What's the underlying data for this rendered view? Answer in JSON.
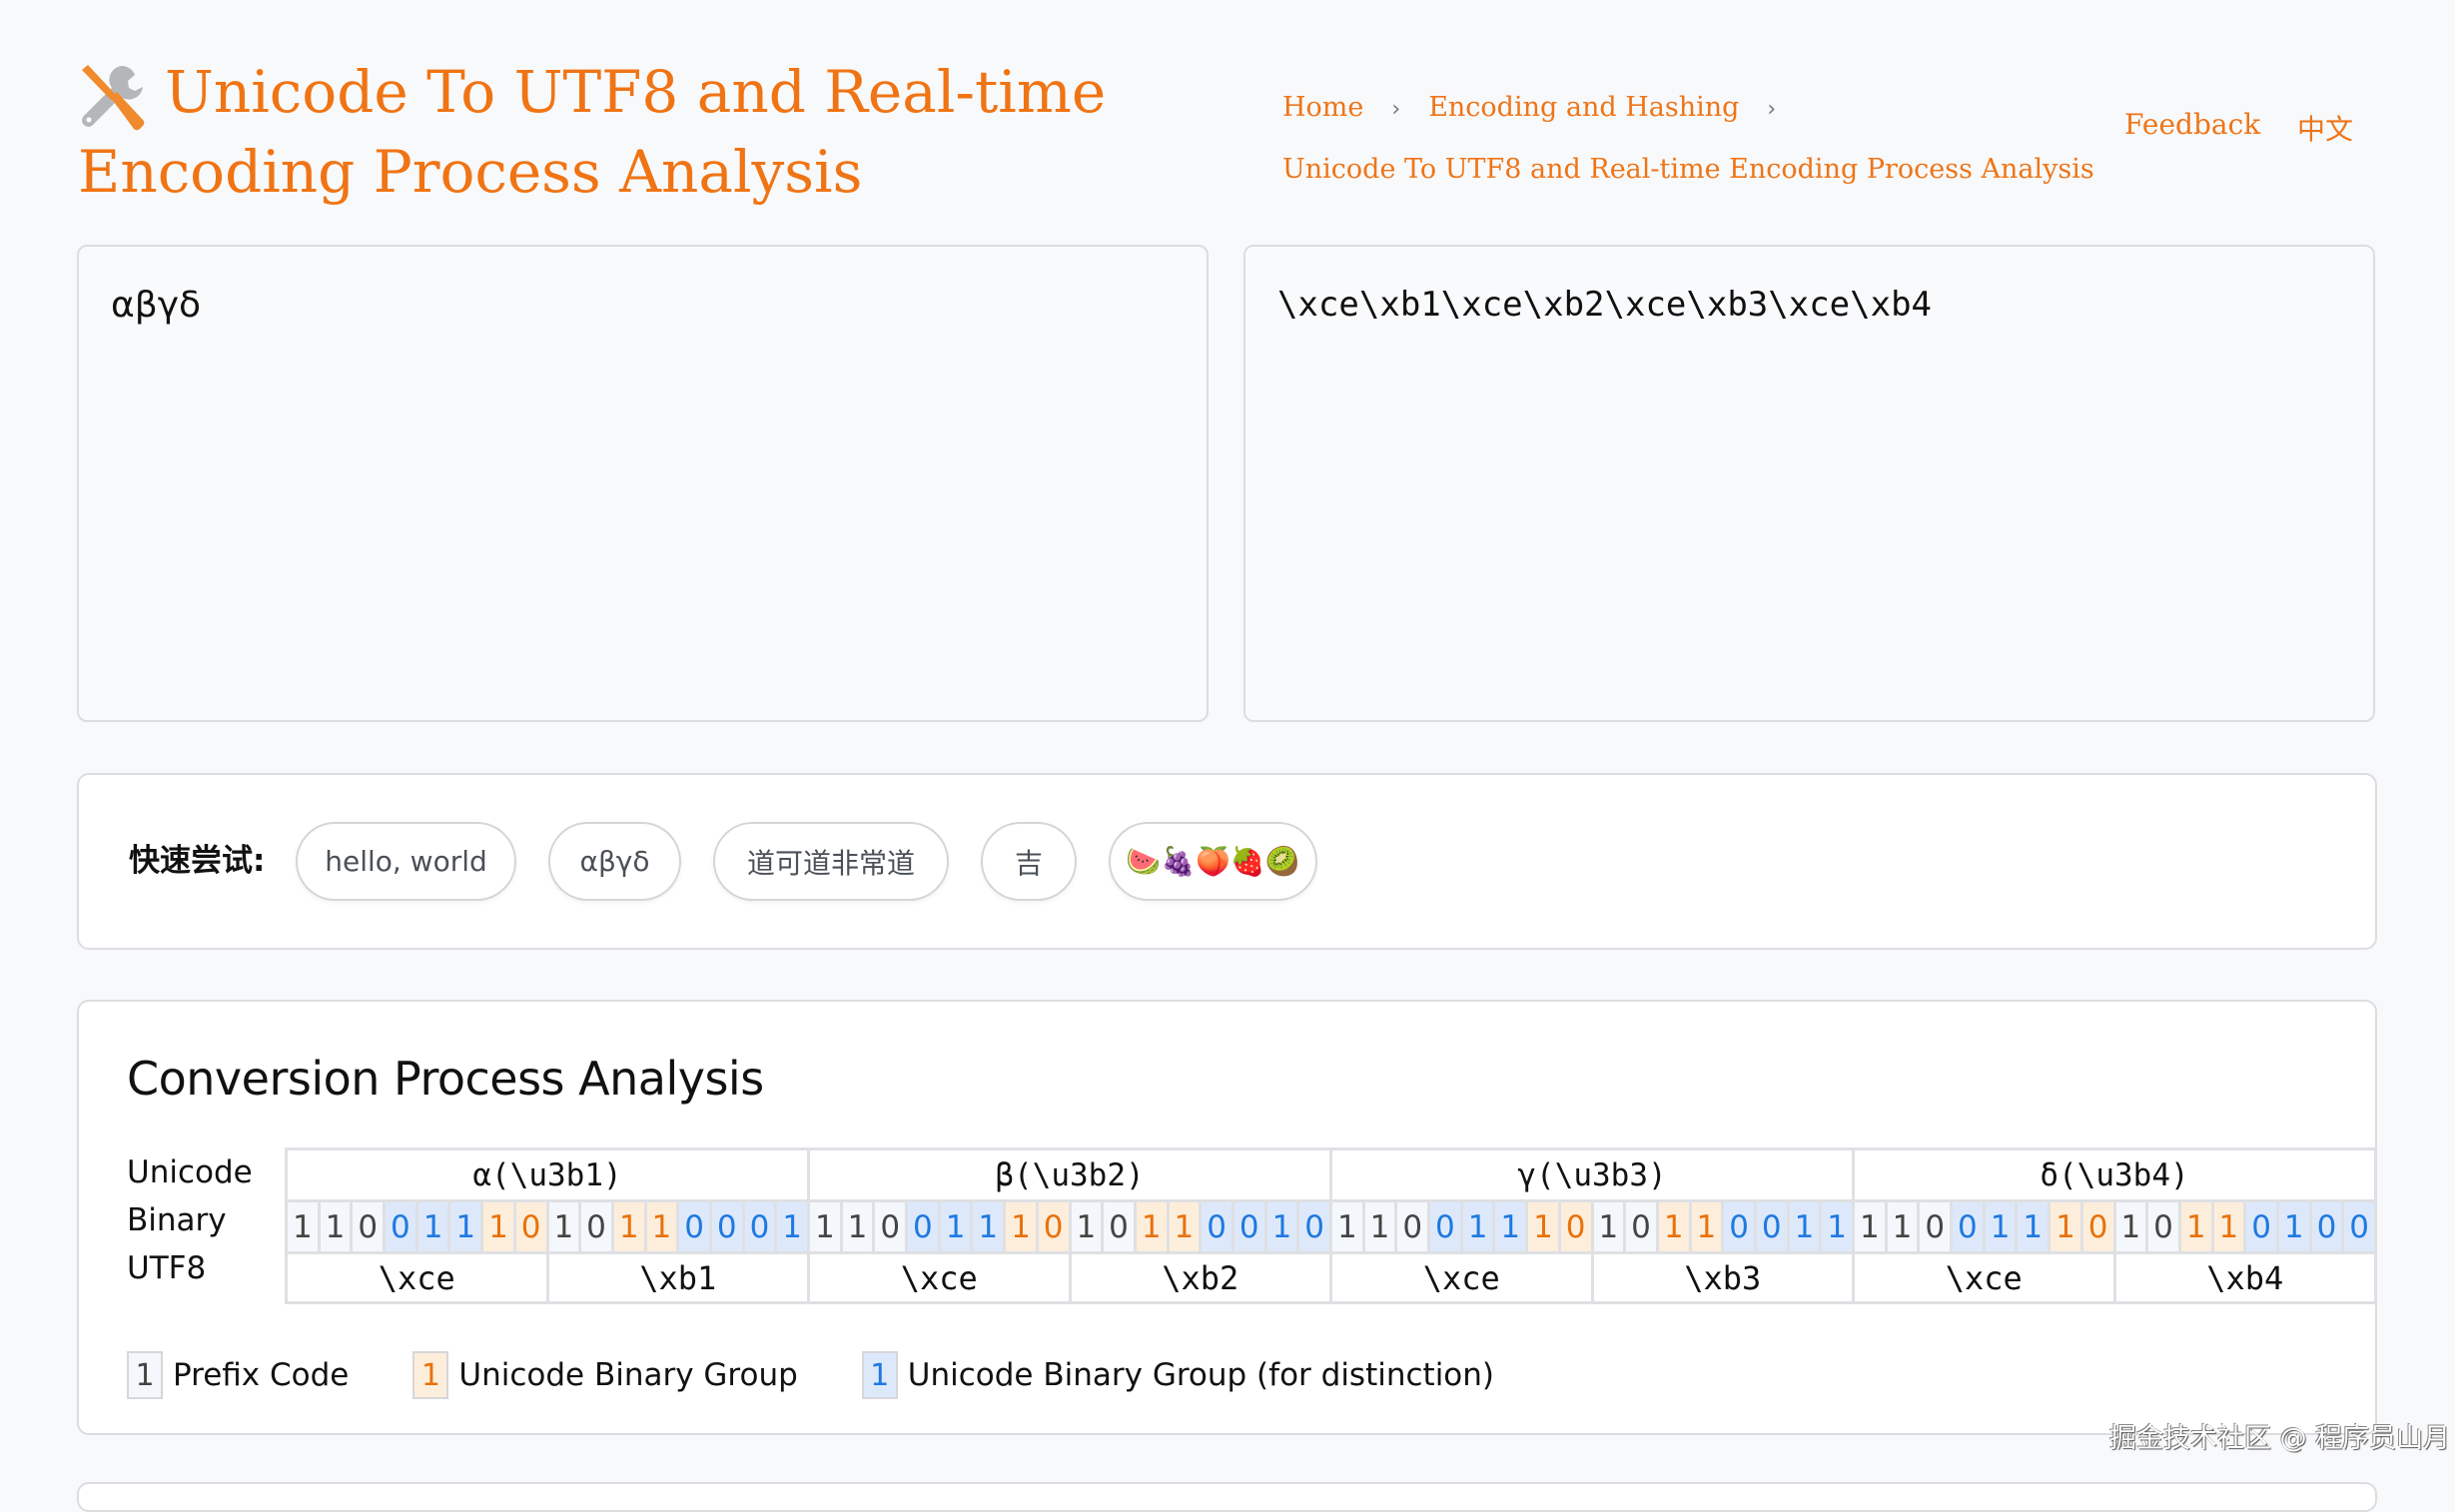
{
  "header": {
    "title_line1": "Unicode To UTF8 and Real-time",
    "title_line2": "Encoding Process Analysis",
    "icon": "tools-icon",
    "brand_color": "#f07414"
  },
  "breadcrumb": {
    "items": [
      "Home",
      "Encoding and Hashing",
      "Unicode To UTF8 and Real-time Encoding Process Analysis"
    ],
    "separator": "›"
  },
  "nav": {
    "feedback": "Feedback",
    "language": "中文"
  },
  "editor": {
    "input_value": "αβγδ",
    "output_value": "\\xce\\xb1\\xce\\xb2\\xce\\xb3\\xce\\xb4"
  },
  "quick_try": {
    "label": "快速尝试:",
    "samples": [
      "hello, world",
      "αβγδ",
      "道可道非常道",
      "吉",
      "🍉🍇🍑🍓🥝"
    ]
  },
  "analysis": {
    "title": "Conversion Process Analysis",
    "row_labels": [
      "Unicode",
      "Binary",
      "UTF8"
    ],
    "chars": [
      {
        "label": "α(\\u3b1)",
        "bytes": [
          {
            "hex": "\\xce",
            "bits": "11001110",
            "types": "pppbbboo"
          },
          {
            "hex": "\\xb1",
            "bits": "10110001",
            "types": "ppoobbbb"
          }
        ]
      },
      {
        "label": "β(\\u3b2)",
        "bytes": [
          {
            "hex": "\\xce",
            "bits": "11001110",
            "types": "pppbbboo"
          },
          {
            "hex": "\\xb2",
            "bits": "10110010",
            "types": "ppoobbbb"
          }
        ]
      },
      {
        "label": "γ(\\u3b3)",
        "bytes": [
          {
            "hex": "\\xce",
            "bits": "11001110",
            "types": "pppbbboo"
          },
          {
            "hex": "\\xb3",
            "bits": "10110011",
            "types": "ppoobbbb"
          }
        ]
      },
      {
        "label": "δ(\\u3b4)",
        "bytes": [
          {
            "hex": "\\xce",
            "bits": "11001110",
            "types": "pppbbboo"
          },
          {
            "hex": "\\xb4",
            "bits": "10110100",
            "types": "ppoobbbb"
          }
        ]
      }
    ],
    "legend": [
      {
        "sample": "1",
        "type": "prefix",
        "label": "Prefix Code"
      },
      {
        "sample": "1",
        "type": "orange",
        "label": "Unicode Binary Group"
      },
      {
        "sample": "1",
        "type": "blue",
        "label": "Unicode Binary Group (for distinction)"
      }
    ],
    "colors": {
      "prefix_bg": "#f4f7fb",
      "group_bg": "#fdeedb",
      "group_text": "#e8720c",
      "alt_bg": "#dde9fb",
      "alt_text": "#1f79e0"
    }
  },
  "watermark": "掘金技术社区 @ 程序员山月"
}
